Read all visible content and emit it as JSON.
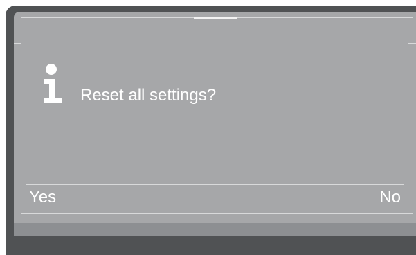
{
  "dialog": {
    "icon": "info-icon",
    "message": "Reset all settings?"
  },
  "softkeys": {
    "left_label": "Yes",
    "right_label": "No"
  },
  "colors": {
    "bezel": "#505254",
    "screen": "#a6a7a9",
    "text": "#ffffff",
    "lines": "#d8d9da"
  }
}
